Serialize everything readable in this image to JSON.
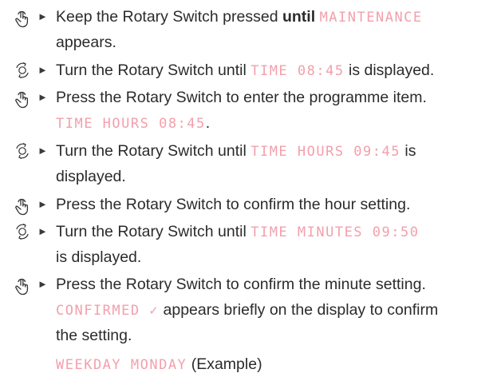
{
  "steps": [
    {
      "icon": "press-icon",
      "lines": [
        {
          "segments": [
            {
              "text": "Keep the Rotary Switch pressed ",
              "style": "plain"
            },
            {
              "text": "until",
              "style": "bold"
            },
            {
              "text": " ",
              "style": "plain"
            },
            {
              "text": "MAINTENANCE",
              "style": "lcd"
            }
          ]
        },
        {
          "segments": [
            {
              "text": "appears.",
              "style": "plain"
            }
          ]
        }
      ]
    },
    {
      "icon": "rotate-icon",
      "lines": [
        {
          "segments": [
            {
              "text": "Turn the Rotary Switch until ",
              "style": "plain"
            },
            {
              "text": "TIME  08:45",
              "style": "lcd"
            },
            {
              "text": " is displayed.",
              "style": "plain"
            }
          ]
        }
      ]
    },
    {
      "icon": "press-icon",
      "lines": [
        {
          "segments": [
            {
              "text": "Press the Rotary Switch to enter the programme item.",
              "style": "plain"
            }
          ]
        },
        {
          "segments": [
            {
              "text": "TIME HOURS 08:45",
              "style": "lcd"
            },
            {
              "text": ".",
              "style": "plain"
            }
          ]
        }
      ]
    },
    {
      "icon": "rotate-icon",
      "lines": [
        {
          "segments": [
            {
              "text": "Turn the Rotary Switch until ",
              "style": "plain"
            },
            {
              "text": "TIME  HOURS  09:45",
              "style": "lcd"
            },
            {
              "text": " is",
              "style": "plain"
            }
          ]
        },
        {
          "segments": [
            {
              "text": "displayed.",
              "style": "plain"
            }
          ]
        }
      ]
    },
    {
      "icon": "press-icon",
      "lines": [
        {
          "segments": [
            {
              "text": "Press the Rotary Switch to confirm the hour setting.",
              "style": "plain"
            }
          ]
        }
      ]
    },
    {
      "icon": "rotate-icon",
      "lines": [
        {
          "segments": [
            {
              "text": "Turn the Rotary Switch until ",
              "style": "plain"
            },
            {
              "text": "TIME MINUTES 09:50",
              "style": "lcd"
            }
          ]
        },
        {
          "segments": [
            {
              "text": "is displayed.",
              "style": "plain"
            }
          ]
        }
      ]
    },
    {
      "icon": "press-icon",
      "lines": [
        {
          "segments": [
            {
              "text": "Press the Rotary Switch to confirm the minute setting.",
              "style": "plain"
            }
          ]
        },
        {
          "segments": [
            {
              "text": "CONFIRMED ✓",
              "style": "lcd"
            },
            {
              "text": " appears briefly on the display to confirm",
              "style": "plain"
            }
          ]
        },
        {
          "segments": [
            {
              "text": "the setting.",
              "style": "plain"
            }
          ]
        },
        {
          "segments": [
            {
              "text": "WEEKDAY MONDAY",
              "style": "lcd"
            },
            {
              "text": " (Example)",
              "style": "plain"
            }
          ]
        }
      ]
    }
  ]
}
